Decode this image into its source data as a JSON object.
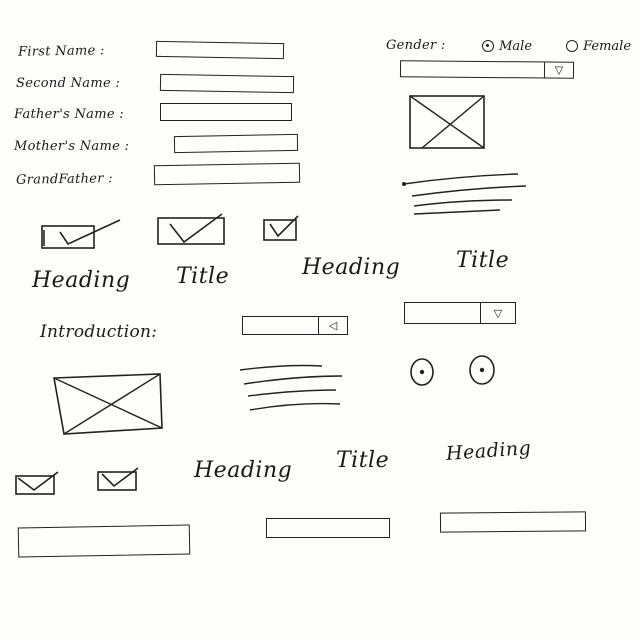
{
  "form": {
    "first_name_label": "First Name :",
    "second_name_label": "Second Name :",
    "fathers_name_label": "Father's Name :",
    "mothers_name_label": "Mother's Name :",
    "grandfather_label": "GrandFather :"
  },
  "gender": {
    "label": "Gender :",
    "options": [
      "Male",
      "Female"
    ],
    "selected": "Male"
  },
  "headings": {
    "row1": [
      "Heading",
      "Title",
      "Heading",
      "Title"
    ],
    "row2": [
      "Heading",
      "Title",
      "Heading"
    ]
  },
  "intro_label": "Introduction:",
  "icons": {
    "dropdown_arrow": "triangle-down-icon",
    "image_placeholder": "image-placeholder-icon",
    "checkbox": "checkbox-checked-icon"
  }
}
